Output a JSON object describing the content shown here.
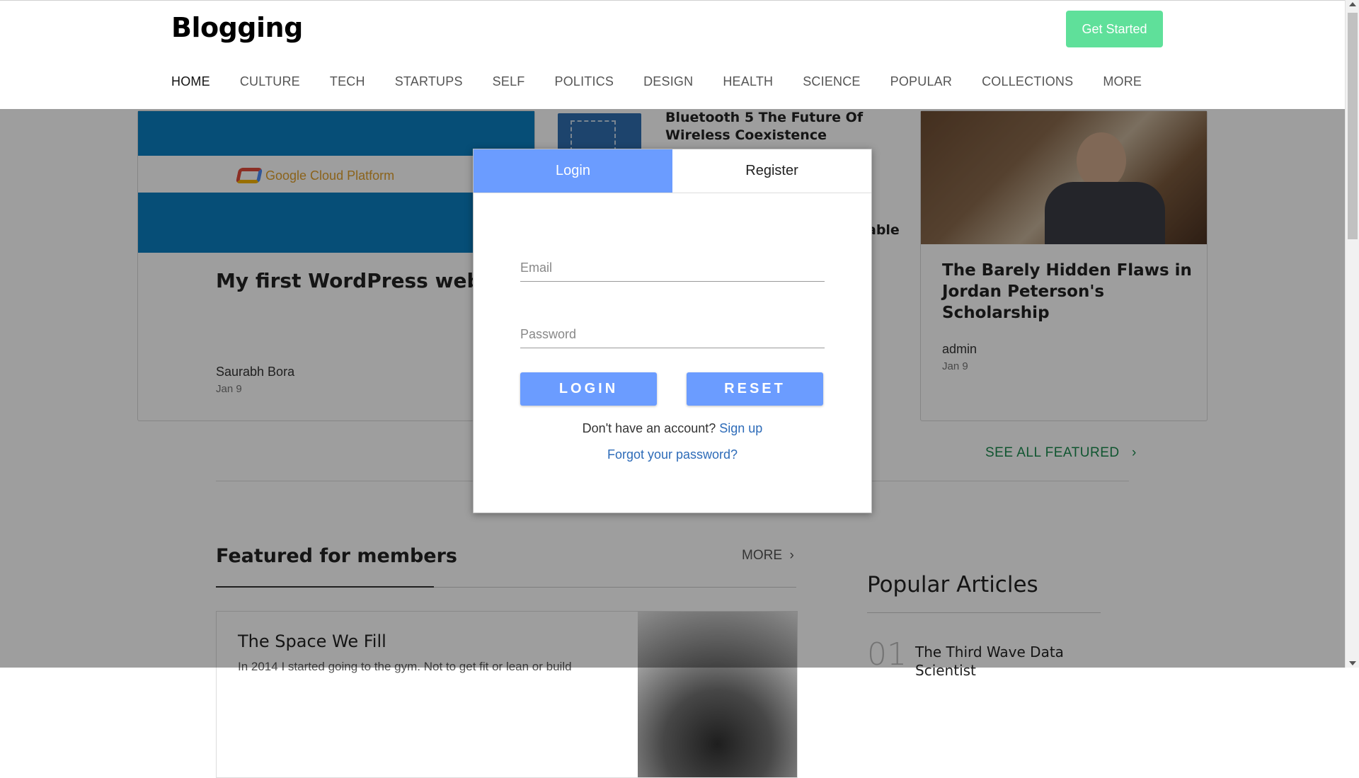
{
  "header": {
    "logo": "Blogging",
    "cta_label": "Get Started",
    "nav": [
      "HOME",
      "CULTURE",
      "TECH",
      "STARTUPS",
      "SELF",
      "POLITICS",
      "DESIGN",
      "HEALTH",
      "SCIENCE",
      "POPULAR",
      "COLLECTIONS",
      "MORE"
    ],
    "active_nav": "HOME"
  },
  "featured": {
    "card1": {
      "image_text": "Google Cloud Platform",
      "title": "My first WordPress website on Google Cloud Platform",
      "author": "Saurabh Bora",
      "date": "Jan 9"
    },
    "middle": {
      "title": "Bluetooth 5 The Future Of Wireless Coexistence",
      "partial_text": "able"
    },
    "card3": {
      "title": "The Barely Hidden Flaws in Jordan Peterson's Scholarship",
      "author": "admin",
      "date": "Jan 9"
    },
    "see_all_label": "SEE ALL FEATURED"
  },
  "members": {
    "section_title": "Featured for members",
    "more_label": "MORE",
    "card": {
      "title": "The Space We Fill",
      "excerpt": "In 2014 I started going to the gym. Not to get fit or lean or build"
    }
  },
  "popular": {
    "title": "Popular Articles",
    "items": [
      {
        "number": "01",
        "title": "The Third Wave Data Scientist"
      }
    ]
  },
  "modal": {
    "tabs": [
      {
        "label": "Login",
        "active": true
      },
      {
        "label": "Register",
        "active": false
      }
    ],
    "email_placeholder": "Email",
    "password_placeholder": "Password",
    "login_label": "LOGIN",
    "reset_label": "RESET",
    "no_account_text": "Don't have an account?",
    "signup_label": "Sign up",
    "forgot_label": "Forgot your password?"
  },
  "colors": {
    "accent": "#6b9cff",
    "cta": "#5fe09a",
    "link": "#2d6bb8",
    "see_all": "#1a8a4e"
  }
}
